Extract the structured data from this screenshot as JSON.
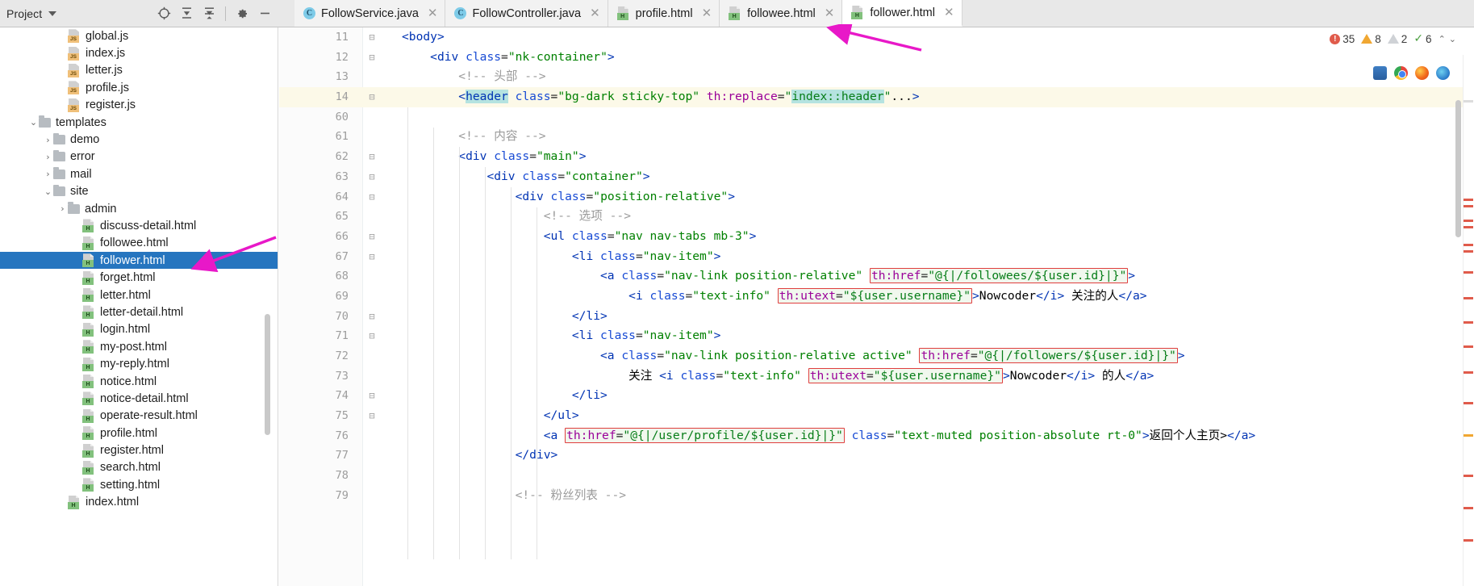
{
  "window": {
    "project_panel_title": "Project",
    "toolbar_icons": [
      "locate-target-icon",
      "expand-all-icon",
      "collapse-all-icon",
      "settings-gear-icon",
      "minimize-icon"
    ]
  },
  "tabs": [
    {
      "label": "FollowService.java",
      "icon": "java-class-icon",
      "active": false
    },
    {
      "label": "FollowController.java",
      "icon": "java-class-icon",
      "active": false
    },
    {
      "label": "profile.html",
      "icon": "html-file-icon",
      "active": false
    },
    {
      "label": "followee.html",
      "icon": "html-file-icon",
      "active": false
    },
    {
      "label": "follower.html",
      "icon": "html-file-icon",
      "active": true
    }
  ],
  "tree": [
    {
      "label": "global.js",
      "indent": 4,
      "icon": "js-file-icon",
      "twisty": "",
      "selected": false
    },
    {
      "label": "index.js",
      "indent": 4,
      "icon": "js-file-icon",
      "twisty": "",
      "selected": false
    },
    {
      "label": "letter.js",
      "indent": 4,
      "icon": "js-file-icon",
      "twisty": "",
      "selected": false
    },
    {
      "label": "profile.js",
      "indent": 4,
      "icon": "js-file-icon",
      "twisty": "",
      "selected": false
    },
    {
      "label": "register.js",
      "indent": 4,
      "icon": "js-file-icon",
      "twisty": "",
      "selected": false
    },
    {
      "label": "templates",
      "indent": 2,
      "icon": "folder-icon",
      "twisty": "v",
      "selected": false
    },
    {
      "label": "demo",
      "indent": 3,
      "icon": "folder-icon",
      "twisty": ">",
      "selected": false
    },
    {
      "label": "error",
      "indent": 3,
      "icon": "folder-icon",
      "twisty": ">",
      "selected": false
    },
    {
      "label": "mail",
      "indent": 3,
      "icon": "folder-icon",
      "twisty": ">",
      "selected": false
    },
    {
      "label": "site",
      "indent": 3,
      "icon": "folder-icon",
      "twisty": "v",
      "selected": false
    },
    {
      "label": "admin",
      "indent": 4,
      "icon": "folder-icon",
      "twisty": ">",
      "selected": false
    },
    {
      "label": "discuss-detail.html",
      "indent": 5,
      "icon": "html-file-icon",
      "twisty": "",
      "selected": false
    },
    {
      "label": "followee.html",
      "indent": 5,
      "icon": "html-file-icon",
      "twisty": "",
      "selected": false
    },
    {
      "label": "follower.html",
      "indent": 5,
      "icon": "html-file-icon",
      "twisty": "",
      "selected": true
    },
    {
      "label": "forget.html",
      "indent": 5,
      "icon": "html-file-icon",
      "twisty": "",
      "selected": false
    },
    {
      "label": "letter.html",
      "indent": 5,
      "icon": "html-file-icon",
      "twisty": "",
      "selected": false
    },
    {
      "label": "letter-detail.html",
      "indent": 5,
      "icon": "html-file-icon",
      "twisty": "",
      "selected": false
    },
    {
      "label": "login.html",
      "indent": 5,
      "icon": "html-file-icon",
      "twisty": "",
      "selected": false
    },
    {
      "label": "my-post.html",
      "indent": 5,
      "icon": "html-file-icon",
      "twisty": "",
      "selected": false
    },
    {
      "label": "my-reply.html",
      "indent": 5,
      "icon": "html-file-icon",
      "twisty": "",
      "selected": false
    },
    {
      "label": "notice.html",
      "indent": 5,
      "icon": "html-file-icon",
      "twisty": "",
      "selected": false
    },
    {
      "label": "notice-detail.html",
      "indent": 5,
      "icon": "html-file-icon",
      "twisty": "",
      "selected": false
    },
    {
      "label": "operate-result.html",
      "indent": 5,
      "icon": "html-file-icon",
      "twisty": "",
      "selected": false
    },
    {
      "label": "profile.html",
      "indent": 5,
      "icon": "html-file-icon",
      "twisty": "",
      "selected": false
    },
    {
      "label": "register.html",
      "indent": 5,
      "icon": "html-file-icon",
      "twisty": "",
      "selected": false
    },
    {
      "label": "search.html",
      "indent": 5,
      "icon": "html-file-icon",
      "twisty": "",
      "selected": false
    },
    {
      "label": "setting.html",
      "indent": 5,
      "icon": "html-file-icon",
      "twisty": "",
      "selected": false
    },
    {
      "label": "index.html",
      "indent": 4,
      "icon": "html-file-icon",
      "twisty": "",
      "selected": false
    }
  ],
  "editor": {
    "line_numbers": [
      "11",
      "12",
      "13",
      "14",
      "60",
      "61",
      "62",
      "63",
      "64",
      "65",
      "66",
      "67",
      "68",
      "69",
      "70",
      "71",
      "72",
      "73",
      "74",
      "75",
      "76",
      "77",
      "78",
      "79"
    ],
    "code_lines": [
      "<body>",
      "    <div class=\"nk-container\">",
      "        <!-- 头部 -->",
      "        <header class=\"bg-dark sticky-top\" th:replace=\"index::header\"...>",
      "",
      "        <!-- 内容 -->",
      "        <div class=\"main\">",
      "            <div class=\"container\">",
      "                <div class=\"position-relative\">",
      "                    <!-- 选项 -->",
      "                    <ul class=\"nav nav-tabs mb-3\">",
      "                        <li class=\"nav-item\">",
      "                            <a class=\"nav-link position-relative\" th:href=\"@{|/followees/${user.id}|}\">",
      "                                <i class=\"text-info\" th:utext=\"${user.username}\">Nowcoder</i> 关注的人</a>",
      "                        </li>",
      "                        <li class=\"nav-item\">",
      "                            <a class=\"nav-link position-relative active\" th:href=\"@{|/followers/${user.id}|}\">",
      "                                关注 <i class=\"text-info\" th:utext=\"${user.username}\">Nowcoder</i> 的人</a>",
      "                        </li>",
      "                    </ul>",
      "                    <a th:href=\"@{|/user/profile/${user.id}|}\" class=\"text-muted position-absolute rt-0\">返回个人主页></a>",
      "                </div>",
      "",
      "                <!-- 粉丝列表 -->"
    ]
  },
  "inspection": {
    "errors": "35",
    "warnings": "8",
    "weak_warnings": "2",
    "typos": "6",
    "error_icon": "error-circle-icon",
    "warning_icon": "warning-triangle-icon",
    "weak_warning_icon": "weak-warning-triangle-icon",
    "typo_icon": "spellcheck-icon"
  },
  "browsers": [
    "ie-browser-icon",
    "chrome-browser-icon",
    "firefox-browser-icon",
    "edge-browser-icon"
  ]
}
